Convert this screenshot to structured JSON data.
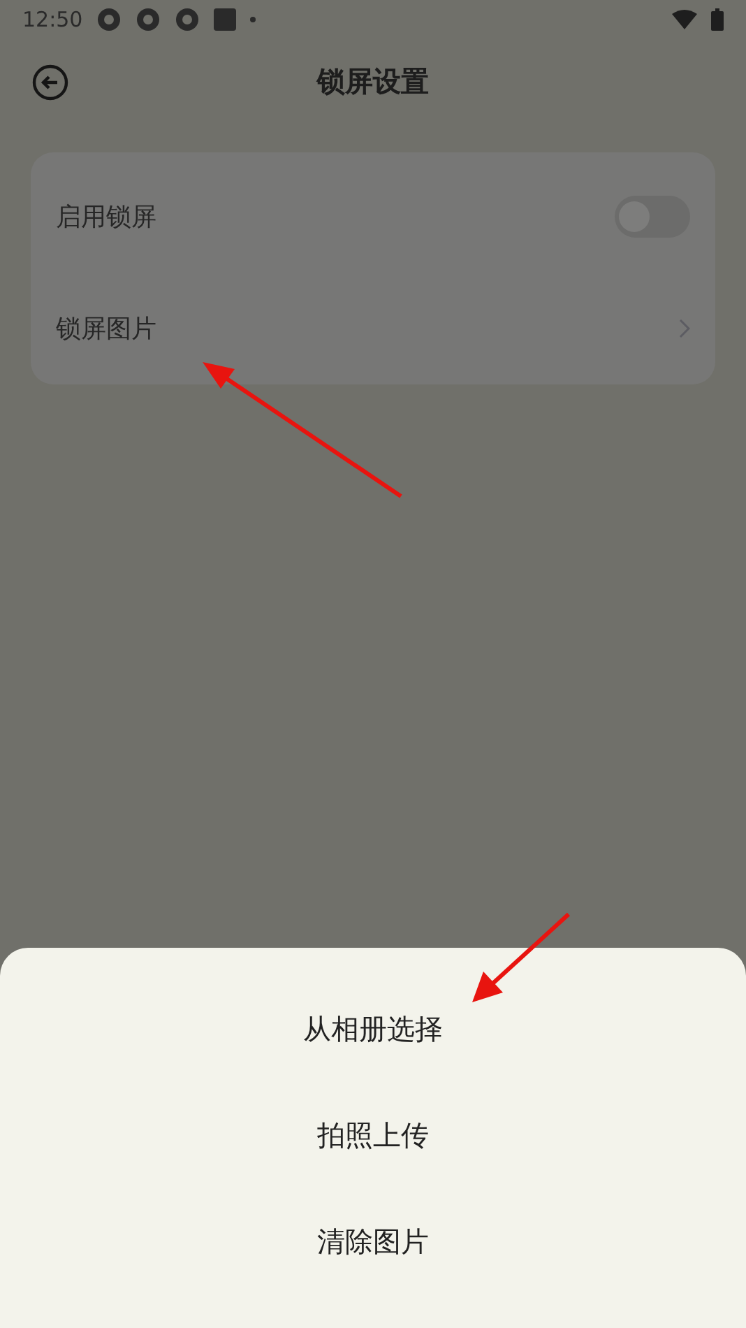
{
  "status_bar": {
    "time": "12:50"
  },
  "header": {
    "title": "锁屏设置"
  },
  "settings": [
    {
      "kind": "toggle",
      "label": "启用锁屏",
      "on": false
    },
    {
      "kind": "link",
      "label": "锁屏图片"
    }
  ],
  "sheet": {
    "options": [
      "从相册选择",
      "拍照上传",
      "清除图片"
    ]
  }
}
